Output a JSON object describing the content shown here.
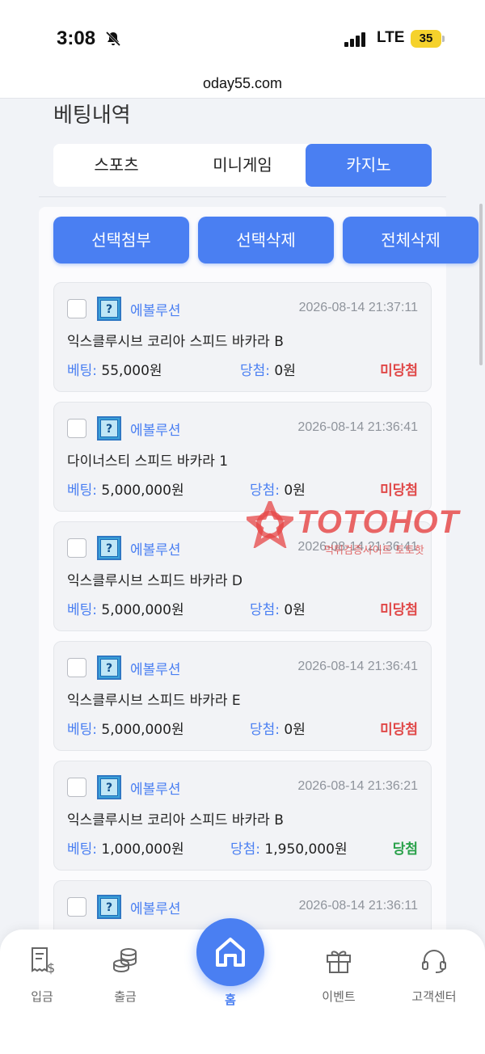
{
  "status_bar": {
    "time": "3:08",
    "network": "LTE",
    "battery": "35"
  },
  "url": "oday55.com",
  "page_title": "베팅내역",
  "tabs": [
    {
      "label": "스포츠",
      "active": false
    },
    {
      "label": "미니게임",
      "active": false
    },
    {
      "label": "카지노",
      "active": true
    }
  ],
  "actions": {
    "attach": "선택첨부",
    "delete_selected": "선택삭제",
    "delete_all": "전체삭제"
  },
  "labels": {
    "bet": "베팅:",
    "win": "당첨:"
  },
  "bets": [
    {
      "provider": "에볼루션",
      "datetime": "2026-08-14 21:37:11",
      "game": "익스클루시브 코리아 스피드 바카라 B",
      "bet": "55,000원",
      "win": "0원",
      "result": "미당첨"
    },
    {
      "provider": "에볼루션",
      "datetime": "2026-08-14 21:36:41",
      "game": "다이너스티 스피드 바카라 1",
      "bet": "5,000,000원",
      "win": "0원",
      "result": "미당첨"
    },
    {
      "provider": "에볼루션",
      "datetime": "2026-08-14 21:36:41",
      "game": "익스클루시브 스피드 바카라 D",
      "bet": "5,000,000원",
      "win": "0원",
      "result": "미당첨"
    },
    {
      "provider": "에볼루션",
      "datetime": "2026-08-14 21:36:41",
      "game": "익스클루시브 스피드 바카라 E",
      "bet": "5,000,000원",
      "win": "0원",
      "result": "미당첨"
    },
    {
      "provider": "에볼루션",
      "datetime": "2026-08-14 21:36:21",
      "game": "익스클루시브 코리아 스피드 바카라 B",
      "bet": "1,000,000원",
      "win": "1,950,000원",
      "result": "당첨"
    },
    {
      "provider": "에볼루션",
      "datetime": "2026-08-14 21:36:11"
    }
  ],
  "watermark": {
    "brand": "TOTOHOT",
    "sub": "먹튀검증사이트 토토핫"
  },
  "nav": {
    "deposit": "입금",
    "withdraw": "출금",
    "home": "홈",
    "event": "이벤트",
    "support": "고객센터"
  },
  "colors": {
    "accent": "#4a7ff2",
    "lose": "#e04848",
    "win": "#2aa14a"
  }
}
